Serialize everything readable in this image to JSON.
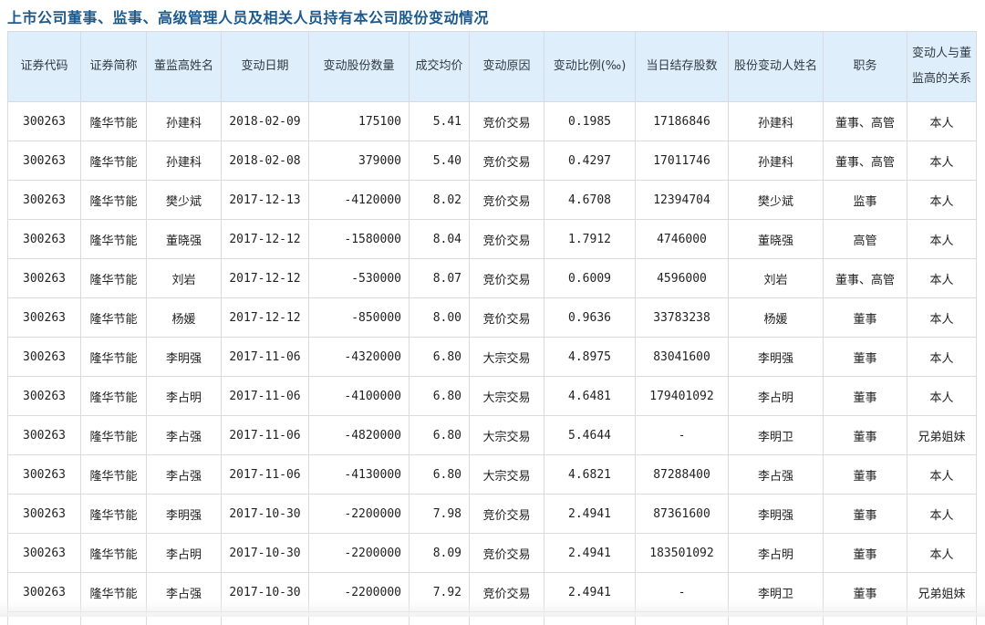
{
  "page": {
    "title": "上市公司董事、监事、高级管理人员及相关人员持有本公司股份变动情况"
  },
  "table": {
    "headers": [
      "证券代码",
      "证券简称",
      "董监高姓名",
      "变动日期",
      "变动股份数量",
      "成交均价",
      "变动原因",
      "变动比例(‰)",
      "当日结存股数",
      "股份变动人姓名",
      "职务",
      "变动人与董监高的关系"
    ],
    "rows": [
      [
        "300263",
        "隆华节能",
        "孙建科",
        "2018-02-09",
        "175100",
        "5.41",
        "竞价交易",
        "0.1985",
        "17186846",
        "孙建科",
        "董事、高管",
        "本人"
      ],
      [
        "300263",
        "隆华节能",
        "孙建科",
        "2018-02-08",
        "379000",
        "5.40",
        "竞价交易",
        "0.4297",
        "17011746",
        "孙建科",
        "董事、高管",
        "本人"
      ],
      [
        "300263",
        "隆华节能",
        "樊少斌",
        "2017-12-13",
        "-4120000",
        "8.02",
        "竞价交易",
        "4.6708",
        "12394704",
        "樊少斌",
        "监事",
        "本人"
      ],
      [
        "300263",
        "隆华节能",
        "董晓强",
        "2017-12-12",
        "-1580000",
        "8.04",
        "竞价交易",
        "1.7912",
        "4746000",
        "董晓强",
        "高管",
        "本人"
      ],
      [
        "300263",
        "隆华节能",
        "刘岩",
        "2017-12-12",
        "-530000",
        "8.07",
        "竞价交易",
        "0.6009",
        "4596000",
        "刘岩",
        "董事、高管",
        "本人"
      ],
      [
        "300263",
        "隆华节能",
        "杨媛",
        "2017-12-12",
        "-850000",
        "8.00",
        "竞价交易",
        "0.9636",
        "33783238",
        "杨媛",
        "董事",
        "本人"
      ],
      [
        "300263",
        "隆华节能",
        "李明强",
        "2017-11-06",
        "-4320000",
        "6.80",
        "大宗交易",
        "4.8975",
        "83041600",
        "李明强",
        "董事",
        "本人"
      ],
      [
        "300263",
        "隆华节能",
        "李占明",
        "2017-11-06",
        "-4100000",
        "6.80",
        "大宗交易",
        "4.6481",
        "179401092",
        "李占明",
        "董事",
        "本人"
      ],
      [
        "300263",
        "隆华节能",
        "李占强",
        "2017-11-06",
        "-4820000",
        "6.80",
        "大宗交易",
        "5.4644",
        "-",
        "李明卫",
        "董事",
        "兄弟姐妹"
      ],
      [
        "300263",
        "隆华节能",
        "李占强",
        "2017-11-06",
        "-4130000",
        "6.80",
        "大宗交易",
        "4.6821",
        "87288400",
        "李占强",
        "董事",
        "本人"
      ],
      [
        "300263",
        "隆华节能",
        "李明强",
        "2017-10-30",
        "-2200000",
        "7.98",
        "竞价交易",
        "2.4941",
        "87361600",
        "李明强",
        "董事",
        "本人"
      ],
      [
        "300263",
        "隆华节能",
        "李占明",
        "2017-10-30",
        "-2200000",
        "8.09",
        "竞价交易",
        "2.4941",
        "183501092",
        "李占明",
        "董事",
        "本人"
      ],
      [
        "300263",
        "隆华节能",
        "李占强",
        "2017-10-30",
        "-2200000",
        "7.92",
        "竞价交易",
        "2.4941",
        "-",
        "李明卫",
        "董事",
        "兄弟姐妹"
      ]
    ]
  }
}
